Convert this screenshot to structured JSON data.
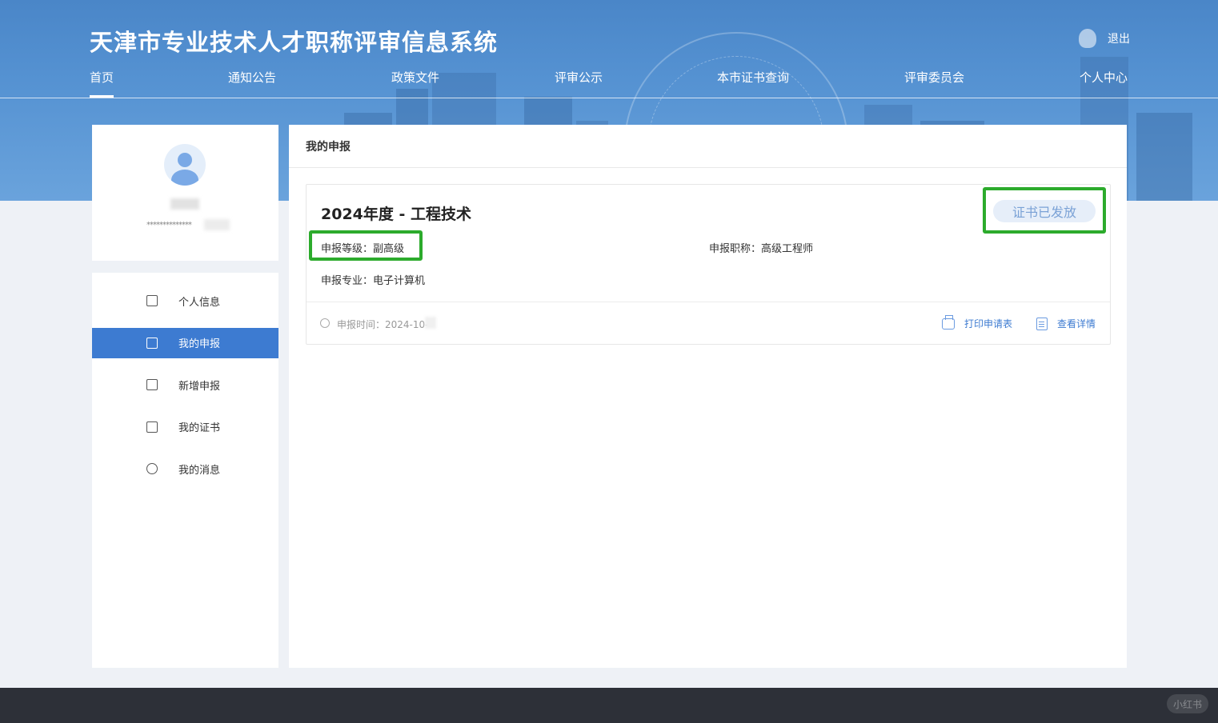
{
  "header": {
    "site_title": "天津市专业技术人才职称评审信息系统",
    "logout_label": "退出",
    "nav": [
      {
        "label": "首页",
        "active": true
      },
      {
        "label": "通知公告"
      },
      {
        "label": "政策文件"
      },
      {
        "label": "评审公示"
      },
      {
        "label": "本市证书查询"
      },
      {
        "label": "评审委员会"
      },
      {
        "label": "个人中心"
      }
    ]
  },
  "profile": {
    "masked_id": "**************"
  },
  "menu": [
    {
      "label": "个人信息",
      "icon": "id-card-icon"
    },
    {
      "label": "我的申报",
      "icon": "document-list-icon",
      "active": true
    },
    {
      "label": "新增申报",
      "icon": "edit-icon"
    },
    {
      "label": "我的证书",
      "icon": "certificate-icon"
    },
    {
      "label": "我的消息",
      "icon": "chat-icon"
    }
  ],
  "main": {
    "section_title": "我的申报",
    "application": {
      "title": "2024年度 - 工程技术",
      "status": "证书已发放",
      "level": "申报等级：副高级",
      "job_title": "申报职称：高级工程师",
      "specialty": "申报专业：电子计算机",
      "submit_time": "申报时间：2024-10-",
      "print_label": "打印申请表",
      "detail_label": "查看详情"
    }
  },
  "colors": {
    "primary": "#3d7bd1",
    "highlight_box": "#2cab2c",
    "footer": "#2d3038"
  },
  "watermark": "小红书"
}
